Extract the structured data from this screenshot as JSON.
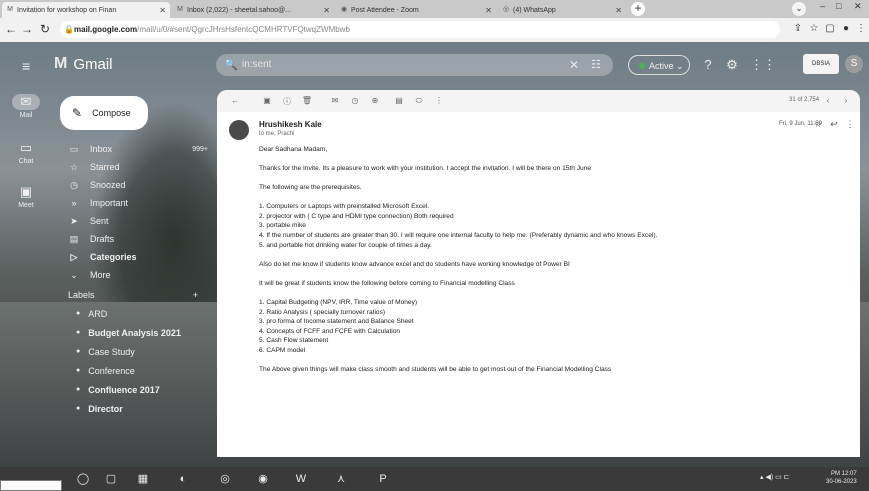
{
  "browser": {
    "tabs": [
      {
        "label": "Invitation for workshop on Finan",
        "icon": "gmail-icon"
      },
      {
        "label": "Inbox (2,022) - sheetal.sahoo@...",
        "icon": "gmail-icon"
      },
      {
        "label": "Post Attendee - Zoom",
        "icon": "zoom-icon"
      },
      {
        "label": "(4) WhatsApp",
        "icon": "whatsapp-icon"
      }
    ],
    "address": "mail.google.com",
    "address_path": "/mail/u/0/#sent/QgrcJHrsHsfentcQCMHRTVFQtwqZWMbwb"
  },
  "gmail": {
    "brand": "Gmail",
    "search_placeholder": "in:sent",
    "status": "Active",
    "org_badge": "DBSIA",
    "avatar_letter": "S",
    "compose": "Compose",
    "rail": [
      {
        "label": "Mail",
        "icon": "mail-icon"
      },
      {
        "label": "Chat",
        "icon": "chat-icon"
      },
      {
        "label": "Meet",
        "icon": "meet-icon"
      }
    ],
    "nav": [
      {
        "label": "Inbox",
        "count": "999+",
        "icon": "inbox-icon"
      },
      {
        "label": "Starred",
        "count": "",
        "icon": "star-icon"
      },
      {
        "label": "Snoozed",
        "count": "",
        "icon": "clock-icon"
      },
      {
        "label": "Important",
        "count": "",
        "icon": "important-icon"
      },
      {
        "label": "Sent",
        "count": "",
        "icon": "send-icon"
      },
      {
        "label": "Drafts",
        "count": "",
        "icon": "draft-icon"
      },
      {
        "label": "Categories",
        "count": "",
        "icon": "categories-icon"
      },
      {
        "label": "More",
        "count": "",
        "icon": "chevron-down-icon"
      }
    ],
    "labels_title": "Labels",
    "labels": [
      {
        "label": "ARD"
      },
      {
        "label": "Budget Analysis 2021"
      },
      {
        "label": "Case Study"
      },
      {
        "label": "Conference"
      },
      {
        "label": "Confluence 2017"
      },
      {
        "label": "Director"
      }
    ]
  },
  "email": {
    "count": "31 of 2,754",
    "sender": "Hrushikesh Kale",
    "to": "to me, Prachi",
    "date": "Fri, 9 Jun, 11:59",
    "greeting": "Dear Sadhana Madam,",
    "para1": "Thanks for the Invite. Its a pleasure to work with your institution. I accept the invitation. I will be there on 15th June",
    "para2": "The following are the prerequisites.",
    "list1": [
      "1. Computers or Laptops with preinstalled Microsoft Excel.",
      "2. projector with ( C type and HDMI type connection) Both required",
      "3. portable mike",
      "4. If the number of students are greater than 30. I will require one internal faculty to help me. (Preferably dynamic and who knows Excel).",
      "5. and portable hot drinking water for couple of times a day."
    ],
    "para3": "Also do let me know if students know advance excel and do students have working knowledge of Power BI",
    "para4": "It will be great if students know the following before coming to Financial modelling Class",
    "list2": [
      "1. Capital Budgeting (NPV, IRR, Time value of Money)",
      "2. Ratio Analysis ( specially turnover ratios)",
      "3. pro forma of Income statement and Balance Sheet",
      "4. Concepts of FCFF and FCFE with Calculation",
      "5. Cash Flow statement",
      "6. CAPM model"
    ],
    "para5": "The Above given things will make class smooth and students will be able to get most out of the Financial Modelling Class"
  },
  "taskbar": {
    "time": "PM 12:07",
    "date": "30-06-2023"
  }
}
